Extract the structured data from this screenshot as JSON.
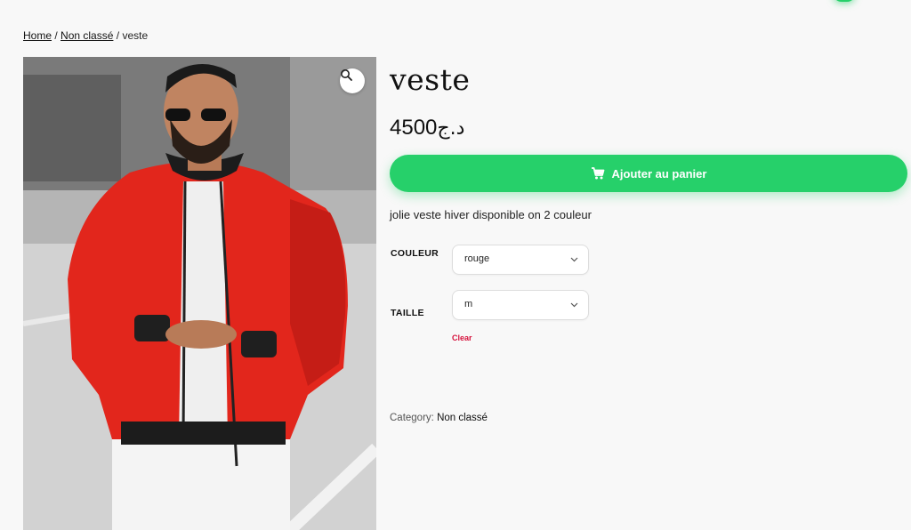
{
  "breadcrumb": {
    "home": "Home",
    "separator": "/",
    "category": "Non classé",
    "current": "veste"
  },
  "product": {
    "title": "veste",
    "price_amount": "4500",
    "price_currency": "د.ج",
    "image_icon": "zoom-magnifier-icon",
    "add_to_cart_label": "Ajouter au panier",
    "add_to_cart_icon": "cart-icon",
    "description": "jolie veste hiver disponible on 2 couleur"
  },
  "variations": {
    "color_label": "COULEUR",
    "color_value": "rouge",
    "size_label": "TAILLE",
    "size_value": "m",
    "clear_label": "Clear"
  },
  "meta": {
    "category_label": "Category:",
    "category_value": "Non classé"
  },
  "colors": {
    "accent": "#26d06a",
    "clear_link": "#d6123c",
    "background": "#f8f8f8"
  }
}
